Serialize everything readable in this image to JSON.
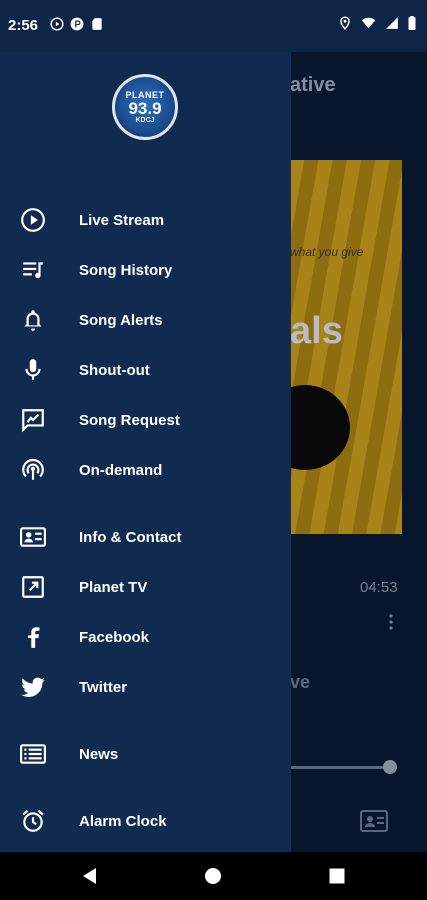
{
  "status_bar": {
    "time": "2:56",
    "left_icons": [
      "play-circle-icon",
      "data-icon",
      "sd-card-icon"
    ],
    "right_icons": [
      "location-icon",
      "wifi-icon",
      "signal-icon",
      "battery-icon"
    ]
  },
  "background": {
    "title_fragment": "ative",
    "album_tagline": "what you give",
    "album_word": "als",
    "duration": "04:53",
    "second_title_fragment": "ve"
  },
  "drawer": {
    "logo": {
      "top": "PLANET",
      "number": "93.9",
      "sub": "KDCJ"
    },
    "items": [
      {
        "label": "Live Stream",
        "icon": "play-circle-icon"
      },
      {
        "label": "Song History",
        "icon": "queue-music-icon"
      },
      {
        "label": "Song Alerts",
        "icon": "bell-icon"
      },
      {
        "label": "Shout-out",
        "icon": "microphone-icon"
      },
      {
        "label": "Song Request",
        "icon": "request-icon"
      },
      {
        "label": "On-demand",
        "icon": "podcast-icon"
      },
      {
        "label": "Info & Contact",
        "icon": "contact-card-icon"
      },
      {
        "label": "Planet TV",
        "icon": "external-link-icon"
      },
      {
        "label": "Facebook",
        "icon": "facebook-icon"
      },
      {
        "label": "Twitter",
        "icon": "twitter-icon"
      },
      {
        "label": "News",
        "icon": "news-list-icon"
      },
      {
        "label": "Alarm Clock",
        "icon": "alarm-clock-icon"
      }
    ]
  },
  "nav_bar": {
    "buttons": [
      "back-icon",
      "home-icon",
      "recents-icon"
    ]
  },
  "colors": {
    "drawer_bg": "#102a50",
    "status_bg": "#0e2548",
    "text": "#ffffff"
  }
}
